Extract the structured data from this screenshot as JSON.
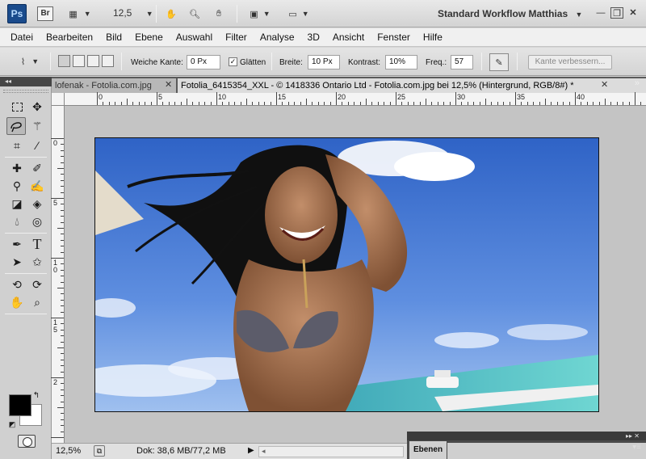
{
  "app": {
    "logo": "Ps",
    "bridge": "Br",
    "zoom": "12,5",
    "workspace": "Standard Workflow Matthias"
  },
  "menu": [
    "Datei",
    "Bearbeiten",
    "Bild",
    "Ebene",
    "Auswahl",
    "Filter",
    "Analyse",
    "3D",
    "Ansicht",
    "Fenster",
    "Hilfe"
  ],
  "options": {
    "feather_label": "Weiche Kante:",
    "feather_value": "0 Px",
    "antialias_label": "Glätten",
    "width_label": "Breite:",
    "width_value": "10 Px",
    "contrast_label": "Kontrast:",
    "contrast_value": "10%",
    "freq_label": "Freq.:",
    "freq_value": "57",
    "refine_edge": "Kante verbessern..."
  },
  "tabs": [
    {
      "label": "lofenak - Fotolia.com.jpg",
      "active": false
    },
    {
      "label": "Fotolia_6415354_XXL - © 1418336 Ontario Ltd - Fotolia.com.jpg bei 12,5% (Hintergrund, RGB/8#) *",
      "active": true
    }
  ],
  "ruler": {
    "h": [
      "0",
      "5",
      "10",
      "15",
      "20",
      "25",
      "30",
      "35",
      "40"
    ],
    "v": [
      "0",
      "5",
      "1 0",
      "1 5",
      "2"
    ]
  },
  "status": {
    "zoom": "12,5%",
    "doc": "Dok: 38,6 MB/77,2 MB"
  },
  "panels": {
    "layers_tab": "Ebenen"
  },
  "colors": {
    "foreground": "#000000",
    "background": "#ffffff",
    "sky": "#4a7fd6",
    "sea": "#4fc0c6"
  }
}
